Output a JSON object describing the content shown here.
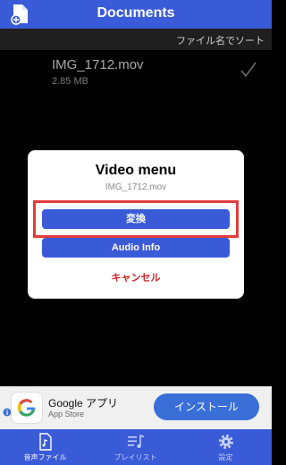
{
  "header": {
    "title": "Documents",
    "add_icon": "document-add-icon"
  },
  "sortbar": {
    "label": "ファイル名でソート"
  },
  "file": {
    "name": "IMG_1712.mov",
    "size": "2.85 MB"
  },
  "dialog": {
    "title": "Video menu",
    "subtitle": "IMG_1712.mov",
    "convert_label": "変換",
    "audio_label": "Audio Info",
    "cancel_label": "キャンセル"
  },
  "ad": {
    "app_name": "Google アプリ",
    "store": "App Store",
    "install_label": "インストール"
  },
  "tabs": [
    {
      "label": "音声ファイル",
      "icon": "audio-file-icon"
    },
    {
      "label": "プレイリスト",
      "icon": "playlist-icon"
    },
    {
      "label": "設定",
      "icon": "gear-icon"
    }
  ],
  "colors": {
    "primary": "#3a5bd7",
    "cancel": "#d02222",
    "highlight": "#e23b3b"
  }
}
